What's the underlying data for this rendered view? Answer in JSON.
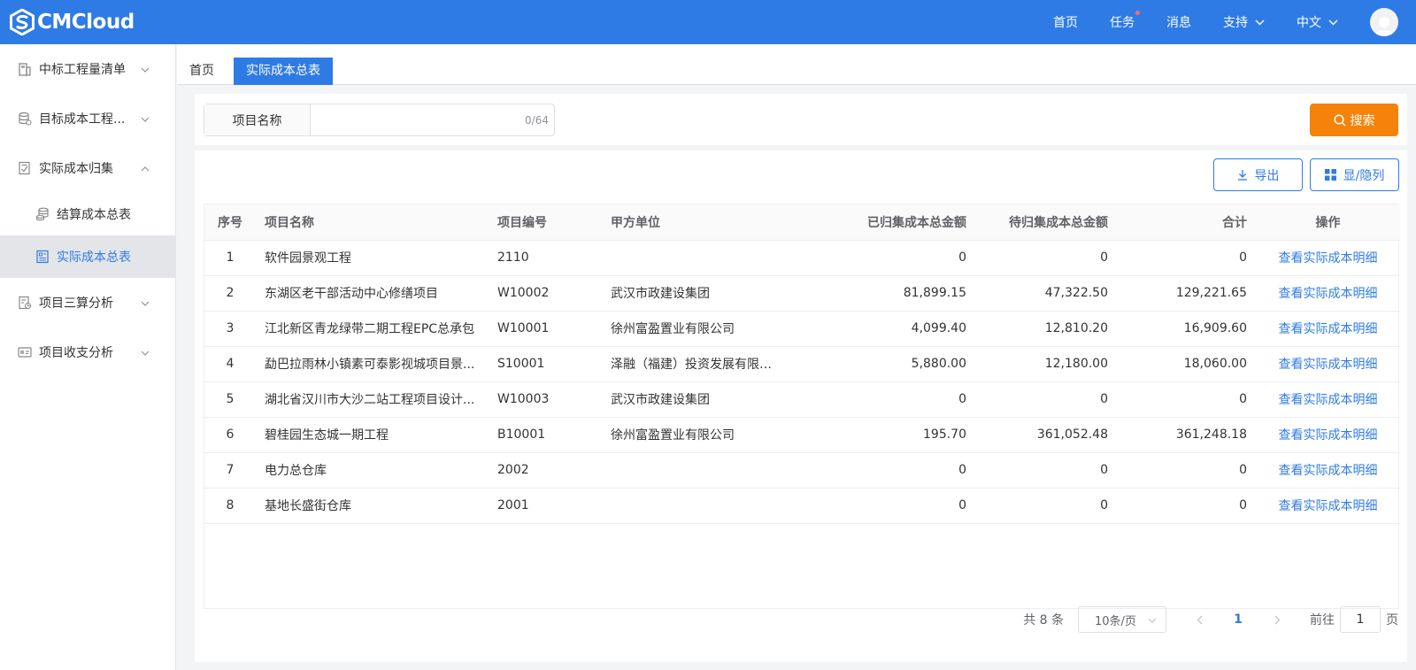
{
  "header": {
    "logo_text": "CMCloud",
    "nav": {
      "home": "首页",
      "tasks": "任务",
      "messages": "消息",
      "support": "支持",
      "language": "中文"
    }
  },
  "sidebar": {
    "items": [
      {
        "label": "中标工程量清单",
        "icon": "building-icon"
      },
      {
        "label": "目标成本工程...",
        "icon": "database-icon"
      },
      {
        "label": "实际成本归集",
        "icon": "ledger-icon"
      },
      {
        "label": "项目三算分析",
        "icon": "chart-doc-icon"
      },
      {
        "label": "项目收支分析",
        "icon": "card-icon"
      }
    ],
    "sub_items": [
      {
        "label": "结算成本总表",
        "icon": "coins-icon"
      },
      {
        "label": "实际成本总表",
        "icon": "report-icon"
      }
    ]
  },
  "tabs": {
    "home": "首页",
    "active": "实际成本总表"
  },
  "search": {
    "label": "项目名称",
    "value": "",
    "counter": "0/64",
    "button": "搜索"
  },
  "toolbar": {
    "export": "导出",
    "toggle_columns": "显/隐列"
  },
  "table": {
    "columns": [
      "序号",
      "项目名称",
      "项目编号",
      "甲方单位",
      "已归集成本总金额",
      "待归集成本总金额",
      "合计",
      "操作"
    ],
    "rows": [
      {
        "no": "1",
        "name": "软件园景观工程",
        "code": "2110",
        "client": "",
        "collected": "0",
        "pending": "0",
        "total": "0",
        "action": "查看实际成本明细"
      },
      {
        "no": "2",
        "name": "东湖区老干部活动中心修缮项目",
        "code": "W10002",
        "client": "武汉市政建设集团",
        "collected": "81,899.15",
        "pending": "47,322.50",
        "total": "129,221.65",
        "action": "查看实际成本明细"
      },
      {
        "no": "3",
        "name": "江北新区青龙绿带二期工程EPC总承包",
        "code": "W10001",
        "client": "徐州富盈置业有限公司",
        "collected": "4,099.40",
        "pending": "12,810.20",
        "total": "16,909.60",
        "action": "查看实际成本明细"
      },
      {
        "no": "4",
        "name": "勐巴拉雨林小镇素可泰影视城项目景...",
        "code": "S10001",
        "client": "泽融（福建）投资发展有限公司",
        "collected": "5,880.00",
        "pending": "12,180.00",
        "total": "18,060.00",
        "action": "查看实际成本明细"
      },
      {
        "no": "5",
        "name": "湖北省汉川市大沙二站工程项目设计...",
        "code": "W10003",
        "client": "武汉市政建设集团",
        "collected": "0",
        "pending": "0",
        "total": "0",
        "action": "查看实际成本明细"
      },
      {
        "no": "6",
        "name": "碧桂园生态城一期工程",
        "code": "B10001",
        "client": "徐州富盈置业有限公司",
        "collected": "195.70",
        "pending": "361,052.48",
        "total": "361,248.18",
        "action": "查看实际成本明细"
      },
      {
        "no": "7",
        "name": "电力总仓库",
        "code": "2002",
        "client": "",
        "collected": "0",
        "pending": "0",
        "total": "0",
        "action": "查看实际成本明细"
      },
      {
        "no": "8",
        "name": "基地长盛街仓库",
        "code": "2001",
        "client": "",
        "collected": "0",
        "pending": "0",
        "total": "0",
        "action": "查看实际成本明细"
      }
    ]
  },
  "pagination": {
    "total_text": "共 8 条",
    "page_size": "10条/页",
    "current_page": "1",
    "goto_label": "前往",
    "goto_value": "1",
    "page_suffix": "页"
  },
  "colors": {
    "primary": "#2f7be6",
    "search_button": "#f5830b",
    "active_sidebar_bg": "#e3e5e8"
  }
}
